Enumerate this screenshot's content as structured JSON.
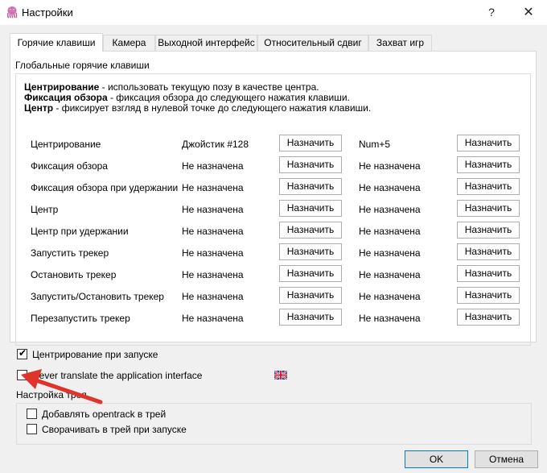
{
  "window": {
    "title": "Настройки",
    "help_symbol": "?",
    "close_symbol": "✕"
  },
  "tabs": [
    {
      "label": "Горячие клавиши",
      "active": true
    },
    {
      "label": "Камера",
      "active": false
    },
    {
      "label": "Выходной интерфейс",
      "active": false
    },
    {
      "label": "Относительный сдвиг",
      "active": false
    },
    {
      "label": "Захват игр",
      "active": false
    }
  ],
  "hotkeys": {
    "group_title": "Глобальные горячие клавиши",
    "desc": [
      {
        "bold": "Центрирование",
        "text": " - использовать текущую позу в качестве центра."
      },
      {
        "bold": "Фиксация обзора",
        "text": " - фиксация обзора до следующего нажатия клавиши."
      },
      {
        "bold": "Центр",
        "text": " - фиксирует взгляд в нулевой точке до следующего нажатия клавиши."
      }
    ],
    "assign_label": "Назначить",
    "rows": [
      {
        "label": "Центрирование",
        "key1": "Джойстик #128",
        "key2": "Num+5"
      },
      {
        "label": "Фиксация обзора",
        "key1": "Не назначена",
        "key2": "Не назначена"
      },
      {
        "label": "Фиксация обзора при удержании",
        "key1": "Не назначена",
        "key2": "Не назначена"
      },
      {
        "label": "Центр",
        "key1": "Не назначена",
        "key2": "Не назначена"
      },
      {
        "label": "Центр при удержании",
        "key1": "Не назначена",
        "key2": "Не назначена"
      },
      {
        "label": "Запустить трекер",
        "key1": "Не назначена",
        "key2": "Не назначена"
      },
      {
        "label": "Остановить трекер",
        "key1": "Не назначена",
        "key2": "Не назначена"
      },
      {
        "label": "Запустить/Остановить трекер",
        "key1": "Не назначена",
        "key2": "Не назначена"
      },
      {
        "label": "Перезапустить трекер",
        "key1": "Не назначена",
        "key2": "Не назначена"
      }
    ]
  },
  "options": {
    "center_on_start": {
      "label": "Центрирование при запуске",
      "checked": true
    },
    "never_translate": {
      "label": "Never translate the application interface",
      "checked": false
    }
  },
  "tray": {
    "title": "Настройка трея",
    "add_to_tray": {
      "label": "Добавлять opentrack в трей",
      "checked": false
    },
    "minimize_on_start": {
      "label": "Сворачивать в трей при запуске",
      "checked": false
    }
  },
  "buttons": {
    "ok": "OK",
    "cancel": "Отмена"
  },
  "colors": {
    "accent": "#0078d7",
    "annotation_arrow": "#e0342a",
    "app_icon": "#d070b0"
  }
}
